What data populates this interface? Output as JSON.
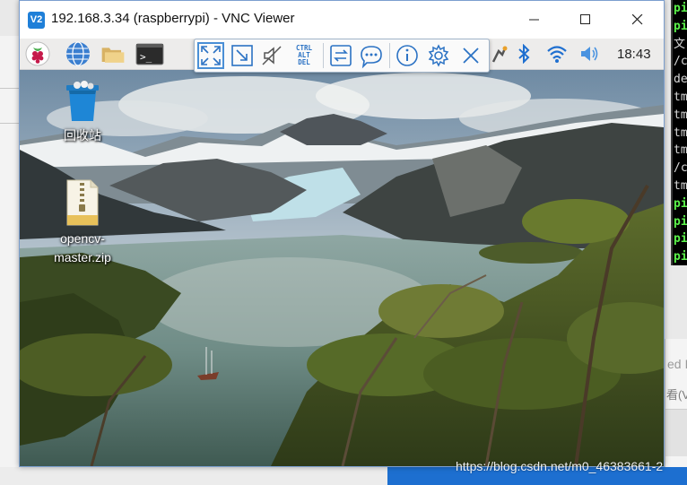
{
  "window": {
    "app_icon_text": "V2",
    "title": "192.168.3.34 (raspberrypi) - VNC Viewer"
  },
  "panel": {
    "clock": "18:43",
    "launcher_icons": [
      "raspberry-menu-icon",
      "browser-globe-icon",
      "file-manager-folder-icon",
      "terminal-icon"
    ],
    "tray_icons": [
      "vnc-server-icon",
      "bluetooth-icon",
      "wifi-icon",
      "volume-icon"
    ]
  },
  "vnc_toolbar": {
    "buttons": [
      "fullscreen-icon",
      "scale-icon",
      "mute-icon",
      "ctrl-alt-del-icon",
      "file-transfer-icon",
      "chat-icon",
      "info-icon",
      "settings-gear-icon",
      "close-toolbar-icon"
    ],
    "cad_lines": [
      "CTRL",
      "ALT",
      "DEL"
    ]
  },
  "desktop": {
    "icons": [
      {
        "label": "回收站",
        "icon": "trash-bin-icon"
      },
      {
        "label_line1": "opencv-",
        "label_line2": "master.zip",
        "icon": "zip-file-icon"
      }
    ]
  },
  "background": {
    "terminal_lines": [
      {
        "text": "pi",
        "style": "g"
      },
      {
        "text": "pi",
        "style": "g"
      },
      {
        "text": "文",
        "style": "w"
      },
      {
        "text": "/c",
        "style": "w"
      },
      {
        "text": "de",
        "style": "w"
      },
      {
        "text": "tm",
        "style": "w"
      },
      {
        "text": "tm",
        "style": "w"
      },
      {
        "text": "tm",
        "style": "w"
      },
      {
        "text": "tm",
        "style": "w"
      },
      {
        "text": "/c",
        "style": "w"
      },
      {
        "text": "tm",
        "style": "w"
      },
      {
        "text": "pi",
        "style": "g"
      },
      {
        "text": "pi",
        "style": "g"
      },
      {
        "text": "pi",
        "style": "g"
      },
      {
        "text": "pi",
        "style": "g"
      }
    ],
    "dialog_text_1": "ed I",
    "dialog_text_2": "看(V"
  },
  "watermark": "https://blog.csdn.net/m0_46383661-2"
}
